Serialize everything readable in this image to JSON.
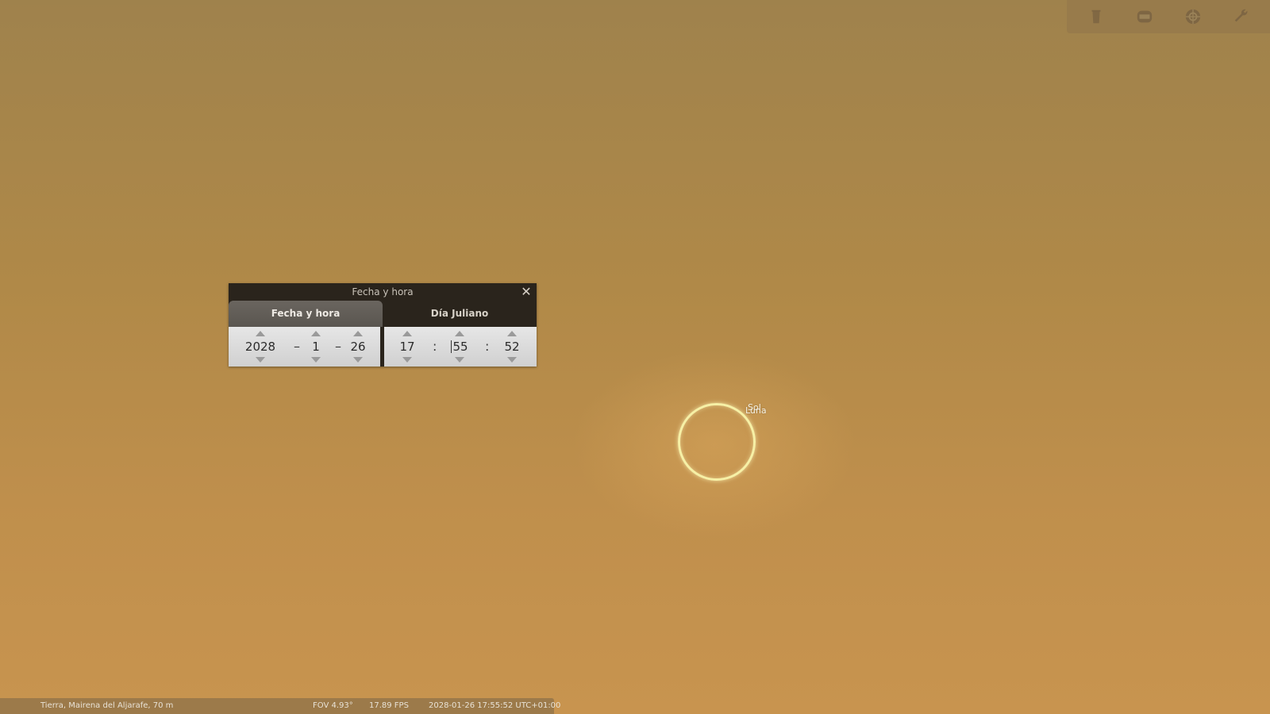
{
  "toolbar": {
    "buttons": [
      {
        "name": "trash-icon"
      },
      {
        "name": "screen-icon"
      },
      {
        "name": "network-icon"
      },
      {
        "name": "wrench-icon"
      }
    ]
  },
  "dialog": {
    "title": "Fecha y hora",
    "tabs": [
      "Fecha y hora",
      "Día Juliano"
    ],
    "date": {
      "year": "2028",
      "month": "1",
      "day": "26",
      "separator": "–"
    },
    "time": {
      "hour": "17",
      "minute": "55",
      "second": "52",
      "separator": ":"
    }
  },
  "sky": {
    "labels": {
      "sun": "Sol",
      "moon": "Luna"
    },
    "ring_color": "#f6f0a6"
  },
  "status": {
    "location": "Tierra, Mairena del Aljarafe, 70 m",
    "fov": "FOV 4.93°",
    "fps": "17.89 FPS",
    "datetime": "2028-01-26 17:55:52 UTC+01:00"
  }
}
